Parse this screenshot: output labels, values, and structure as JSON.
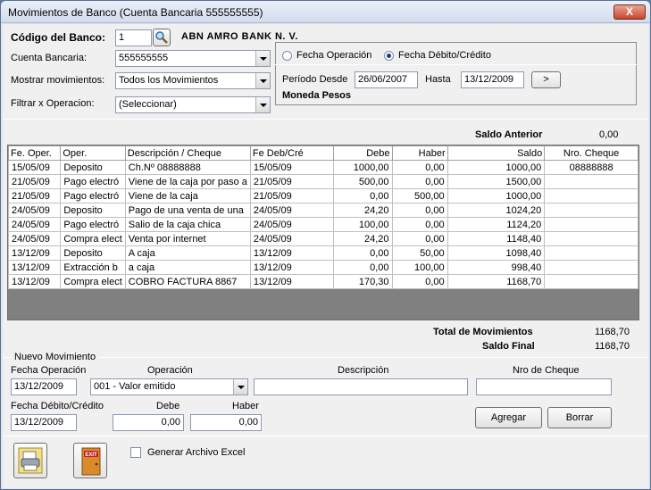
{
  "window": {
    "title": "Movimientos de Banco (Cuenta Bancaria 555555555)",
    "close_label": "X"
  },
  "bank": {
    "code_label": "Código del Banco:",
    "code_value": "1",
    "name": "ABN AMRO BANK N. V.",
    "account_label": "Cuenta Bancaria:",
    "account_value": "555555555",
    "show_label": "Mostrar movimientos:",
    "show_value": "Todos los Movimientos",
    "filter_label": "Filtrar x Operacion:",
    "filter_value": "(Seleccionar)"
  },
  "date_mode": {
    "option1": "Fecha Operación",
    "option2": "Fecha Débito/Crédito",
    "selected": "option2",
    "from_label": "Período Desde",
    "from_value": "26/06/2007",
    "to_label": "Hasta",
    "to_value": "13/12/2009",
    "go_label": ">",
    "currency": "Moneda Pesos"
  },
  "saldo_anterior": {
    "label": "Saldo Anterior",
    "value": "0,00"
  },
  "table": {
    "headers": [
      "Fe. Oper.",
      "Oper.",
      "Descripción / Cheque",
      "Fe Deb/Cré",
      "Debe",
      "Haber",
      "Saldo",
      "Nro. Cheque"
    ],
    "rows": [
      [
        "15/05/09",
        "Deposito",
        "Ch.Nº 08888888",
        "15/05/09",
        "1000,00",
        "0,00",
        "1000,00",
        "08888888"
      ],
      [
        "21/05/09",
        "Pago electró",
        "Viene de la caja por paso a",
        "21/05/09",
        "500,00",
        "0,00",
        "1500,00",
        ""
      ],
      [
        "21/05/09",
        "Pago electró",
        "Viene de la caja",
        "21/05/09",
        "0,00",
        "500,00",
        "1000,00",
        ""
      ],
      [
        "24/05/09",
        "Deposito",
        "Pago de una venta de una",
        "24/05/09",
        "24,20",
        "0,00",
        "1024,20",
        ""
      ],
      [
        "24/05/09",
        "Pago electró",
        "Salio de la caja chica",
        "24/05/09",
        "100,00",
        "0,00",
        "1124,20",
        ""
      ],
      [
        "24/05/09",
        "Compra elect",
        "Venta por internet",
        "24/05/09",
        "24,20",
        "0,00",
        "1148,40",
        ""
      ],
      [
        "13/12/09",
        "Deposito",
        "A caja",
        "13/12/09",
        "0,00",
        "50,00",
        "1098,40",
        ""
      ],
      [
        "13/12/09",
        "Extracción b",
        "a caja",
        "13/12/09",
        "0,00",
        "100,00",
        "998,40",
        ""
      ],
      [
        "13/12/09",
        "Compra elect",
        "COBRO FACTURA 8867",
        "13/12/09",
        "170,30",
        "0,00",
        "1168,70",
        ""
      ]
    ]
  },
  "totals": {
    "total_label": "Total de Movimientos",
    "total_value": "1168,70",
    "final_label": "Saldo Final",
    "final_value": "1168,70"
  },
  "new_movement": {
    "group_label": "Nuevo Movimiento",
    "fecha_op_label": "Fecha Operación",
    "fecha_op_value": "13/12/2009",
    "operacion_label": "Operación",
    "operacion_value": "001 - Valor emitido",
    "descripcion_label": "Descripción",
    "descripcion_value": "",
    "cheque_label": "Nro de Cheque",
    "cheque_value": "",
    "fecha_dc_label": "Fecha Débito/Crédito",
    "fecha_dc_value": "13/12/2009",
    "debe_label": "Debe",
    "debe_value": "0,00",
    "haber_label": "Haber",
    "haber_value": "0,00",
    "add_label": "Agregar",
    "delete_label": "Borrar"
  },
  "footer": {
    "excel_label": "Generar Archivo Excel",
    "exit_text": "EXIT"
  }
}
